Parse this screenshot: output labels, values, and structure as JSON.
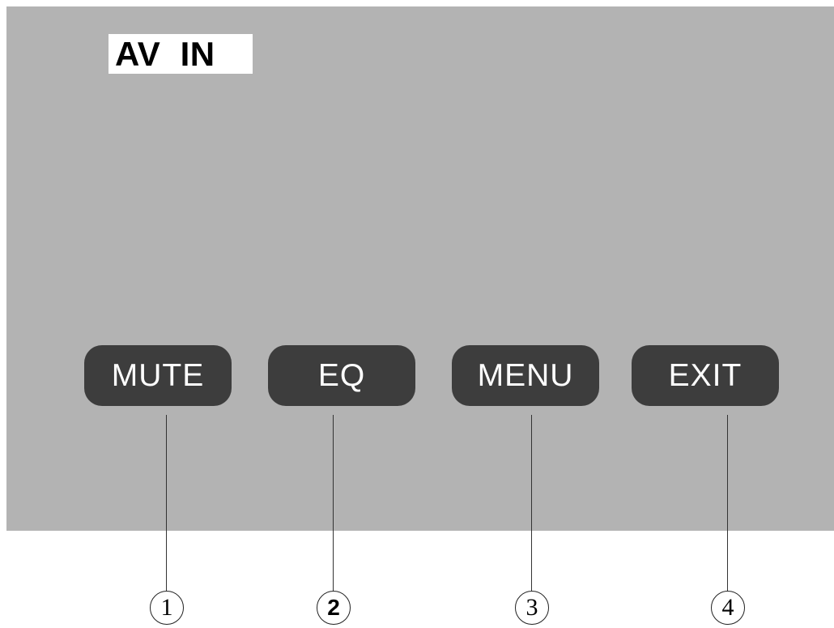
{
  "screen": {
    "source_label": "AV  IN"
  },
  "buttons": [
    {
      "label": "MUTE"
    },
    {
      "label": "EQ"
    },
    {
      "label": "MENU"
    },
    {
      "label": "EXIT"
    }
  ],
  "callouts": [
    "1",
    "2",
    "3",
    "4"
  ],
  "colors": {
    "screen_background": "#b3b3b3",
    "button_fill": "#3d3d3d",
    "button_text": "#ffffff",
    "page_background": "#ffffff"
  }
}
